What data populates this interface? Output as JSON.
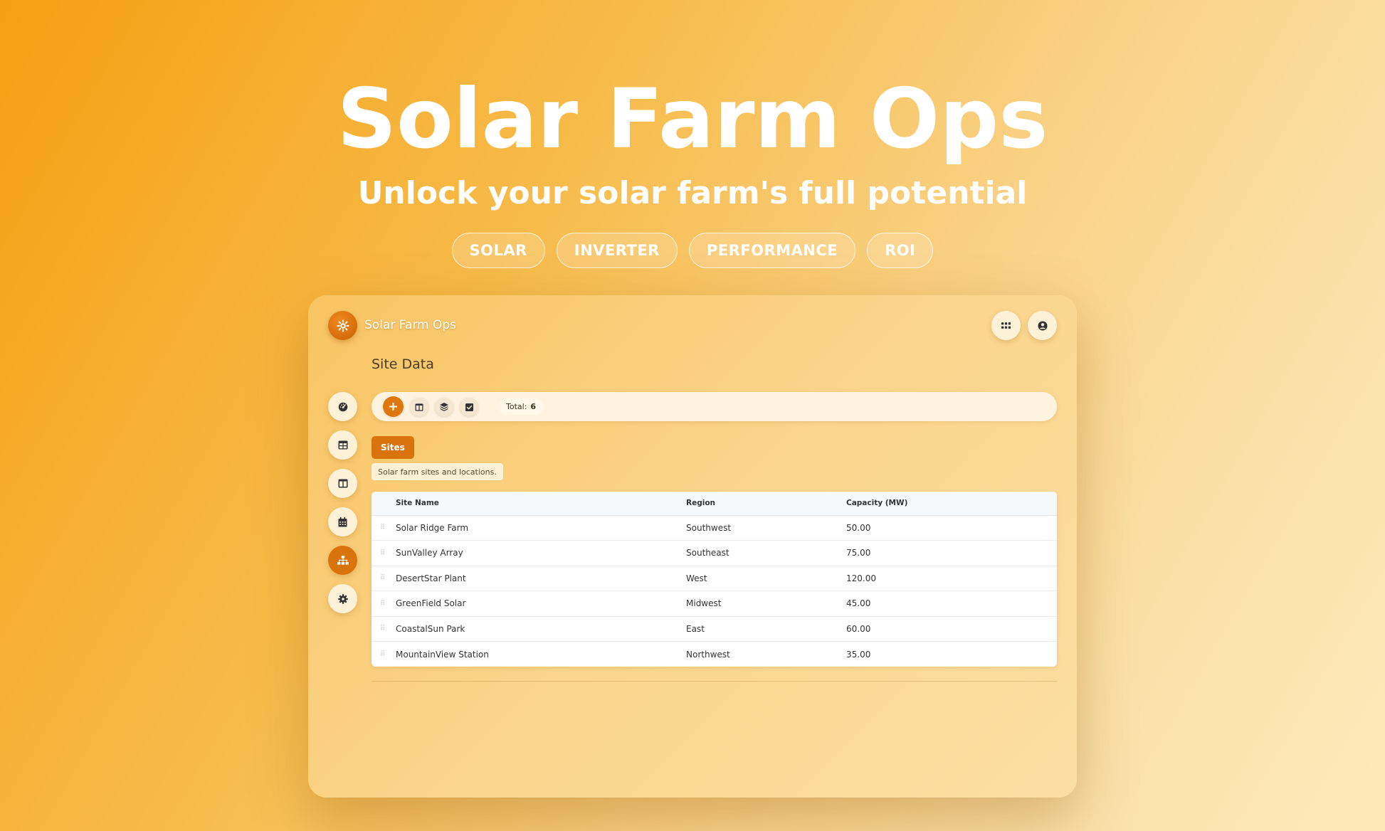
{
  "hero": {
    "title": "Solar Farm Ops",
    "subtitle": "Unlock your solar farm's full potential",
    "tags": [
      "SOLAR",
      "INVERTER",
      "PERFORMANCE",
      "ROI"
    ]
  },
  "app": {
    "name": "Solar Farm Ops",
    "page_title": "Site Data",
    "toolbar": {
      "total_label": "Total:",
      "total_value": "6"
    },
    "tab": {
      "label": "Sites",
      "description": "Solar farm sites and locations."
    },
    "table": {
      "columns": [
        "Site Name",
        "Region",
        "Capacity (MW)"
      ],
      "rows": [
        [
          "Solar Ridge Farm",
          "Southwest",
          "50.00"
        ],
        [
          "SunValley Array",
          "Southeast",
          "75.00"
        ],
        [
          "DesertStar Plant",
          "West",
          "120.00"
        ],
        [
          "GreenField Solar",
          "Midwest",
          "45.00"
        ],
        [
          "CoastalSun Park",
          "East",
          "60.00"
        ],
        [
          "MountainView Station",
          "Northwest",
          "35.00"
        ]
      ]
    },
    "sidebar_icons": [
      "dashboard-icon",
      "table-icon",
      "columns-icon",
      "calendar-icon",
      "sitemap-icon",
      "settings-icon"
    ],
    "active_sidebar_index": 4,
    "colors": {
      "accent": "#d9730c",
      "background_start": "#f5a012",
      "background_end": "#fde9b8"
    }
  }
}
